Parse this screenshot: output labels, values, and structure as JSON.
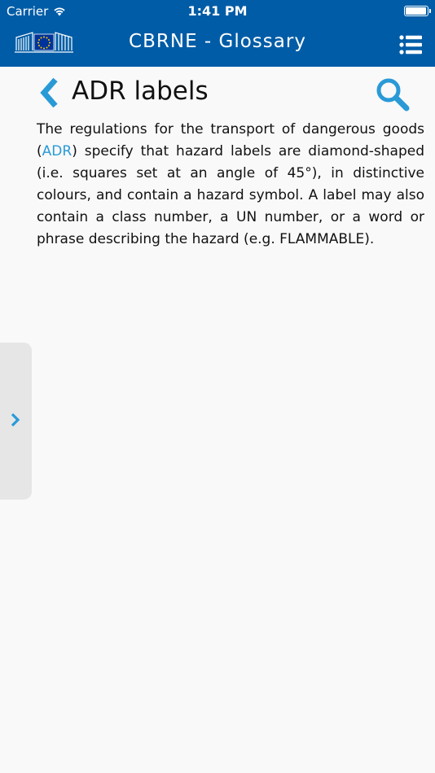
{
  "status_bar": {
    "carrier": "Carrier",
    "time": "1:41 PM",
    "battery_level": 0.95
  },
  "nav": {
    "title": "CBRNE - Glossary",
    "menu_icon": "list-menu-icon",
    "logo": "european-commission-logo"
  },
  "article": {
    "title": "ADR labels",
    "back_icon": "chevron-left-icon",
    "search_icon": "search-icon",
    "body_before_link": "The regulations for the transport of dangerous goods (",
    "link_text": "ADR",
    "body_after_link": ") specify that hazard labels are diamond-shaped (i.e. squares set at an angle of 45°), in distinctive colours, and contain a hazard symbol. A label may also contain a class number, a UN number, or a word or phrase describing the hazard (e.g. FLAMMABLE)."
  },
  "drawer": {
    "icon": "chevron-right-icon"
  },
  "colors": {
    "header_bg": "#005ca6",
    "accent": "#2a9ad7",
    "page_bg": "#f9f9f9",
    "drawer_bg": "#e6e6e6"
  }
}
